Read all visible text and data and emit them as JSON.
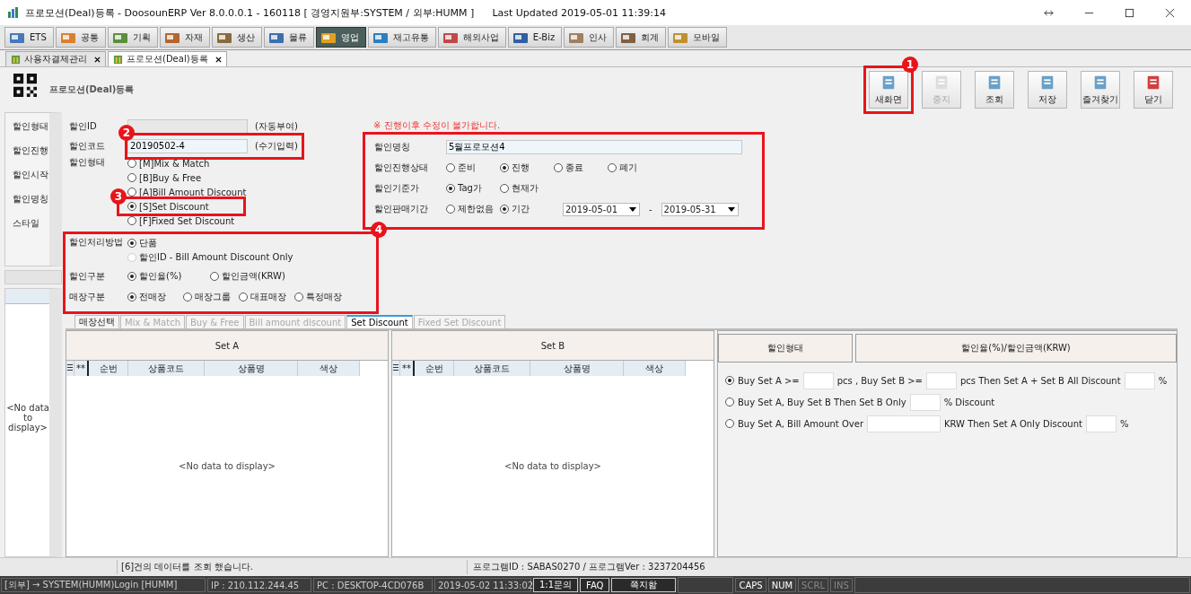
{
  "window": {
    "title": "프로모션(Deal)등록 - DoosounERP Ver 8.0.0.0.1 - 160118 [ 경영지원부:SYSTEM / 외부:HUMM ]",
    "last_updated": "Last Updated 2019-05-01 11:39:14"
  },
  "module_tabs": [
    {
      "label": "ETS",
      "selected": false
    },
    {
      "label": "공통",
      "selected": false
    },
    {
      "label": "기획",
      "selected": false
    },
    {
      "label": "자재",
      "selected": false
    },
    {
      "label": "생산",
      "selected": false
    },
    {
      "label": "물류",
      "selected": false
    },
    {
      "label": "영업",
      "selected": true
    },
    {
      "label": "재고유통",
      "selected": false
    },
    {
      "label": "해외사업",
      "selected": false
    },
    {
      "label": "E-Biz",
      "selected": false
    },
    {
      "label": "인사",
      "selected": false
    },
    {
      "label": "회계",
      "selected": false
    },
    {
      "label": "모바일",
      "selected": false
    }
  ],
  "doc_tabs": [
    {
      "label": "사용자결제관리",
      "selected": false
    },
    {
      "label": "프로모션(Deal)등록",
      "selected": true
    }
  ],
  "page_title": "프로모션(Deal)등록",
  "toolbar": [
    {
      "label": "새화면",
      "disabled": false,
      "annotation": "1"
    },
    {
      "label": "중지",
      "disabled": true
    },
    {
      "label": "조회",
      "disabled": false
    },
    {
      "label": "저장",
      "disabled": false
    },
    {
      "label": "즐겨찾기",
      "disabled": false
    },
    {
      "label": "닫기",
      "disabled": false
    }
  ],
  "sidebar": {
    "filters": [
      "할인형태",
      "할인진행",
      "할인시작",
      "할인명칭",
      "스타일"
    ],
    "empty": "<No data to display>"
  },
  "form": {
    "id": {
      "label": "할인ID",
      "note": "(자동부여)"
    },
    "code": {
      "label": "할인코드",
      "value": "20190502-4",
      "note": "(수기입력)",
      "annotation": "2"
    },
    "type": {
      "label": "할인형태",
      "options": [
        {
          "label": "[M]Mix & Match",
          "selected": false
        },
        {
          "label": "[B]Buy & Free",
          "selected": false
        },
        {
          "label": "[A]Bill Amount Discount",
          "selected": false
        },
        {
          "label": "[S]Set Discount",
          "selected": true,
          "annotation": "3"
        },
        {
          "label": "[F]Fixed Set Discount",
          "selected": false
        }
      ]
    },
    "annotation": "4",
    "method": {
      "label": "할인처리방법",
      "options": [
        {
          "label": "단품",
          "selected": true,
          "disabled": false
        },
        {
          "label": "할인ID - Bill Amount Discount Only",
          "selected": false,
          "disabled": true
        }
      ]
    },
    "dc_kind": {
      "label": "할인구분",
      "options": [
        {
          "label": "할인율(%)",
          "selected": true
        },
        {
          "label": "할인금액(KRW)",
          "selected": false
        }
      ]
    },
    "store": {
      "label": "매장구분",
      "options": [
        {
          "label": "전매장",
          "selected": true
        },
        {
          "label": "매장그룹",
          "selected": false
        },
        {
          "label": "대표매장",
          "selected": false
        },
        {
          "label": "특정매장",
          "selected": false
        }
      ]
    },
    "warning": "※ 진행이후 수정이 불가합니다.",
    "name": {
      "label": "할인명칭",
      "value": "5월프로모션4"
    },
    "status": {
      "label": "할인진행상태",
      "options": [
        {
          "label": "준비",
          "selected": false
        },
        {
          "label": "진행",
          "selected": true
        },
        {
          "label": "종료",
          "selected": false
        },
        {
          "label": "폐기",
          "selected": false
        }
      ]
    },
    "base": {
      "label": "할인기준가",
      "options": [
        {
          "label": "Tag가",
          "selected": true
        },
        {
          "label": "현재가",
          "selected": false
        }
      ]
    },
    "period": {
      "label": "할인판매기간",
      "options": [
        {
          "label": "제한없음",
          "selected": false
        },
        {
          "label": "기간",
          "selected": true
        }
      ],
      "from": "2019-05-01",
      "separator": "-",
      "to": "2019-05-31"
    }
  },
  "detail_tabs": [
    {
      "label": "매장선택",
      "selected": false,
      "disabled": false
    },
    {
      "label": "Mix & Match",
      "selected": false,
      "disabled": true
    },
    {
      "label": "Buy & Free",
      "selected": false,
      "disabled": true
    },
    {
      "label": "Bill amount discount",
      "selected": false,
      "disabled": true
    },
    {
      "label": "Set Discount",
      "selected": true,
      "disabled": false
    },
    {
      "label": "Fixed Set Discount",
      "selected": false,
      "disabled": true
    }
  ],
  "grids": [
    {
      "title": "Set A",
      "marker": "**",
      "columns": [
        "순번",
        "상품코드",
        "상품명",
        "색상"
      ],
      "empty": "<No data to display>"
    },
    {
      "title": "Set B",
      "marker": "**",
      "columns": [
        "순번",
        "상품코드",
        "상품명",
        "색상"
      ],
      "empty": "<No data to display>"
    }
  ],
  "set_panel": {
    "headers": [
      "할인형태",
      "할인율(%)/할인금액(KRW)"
    ],
    "rows": [
      {
        "selected": true,
        "parts": [
          {
            "kind": "text",
            "text": "Buy Set A >="
          },
          {
            "kind": "field"
          },
          {
            "kind": "text",
            "text": "pcs , Buy Set B >="
          },
          {
            "kind": "field"
          },
          {
            "kind": "text",
            "text": "pcs Then Set A + Set B All Discount"
          },
          {
            "kind": "field"
          },
          {
            "kind": "text",
            "text": "%"
          }
        ]
      },
      {
        "selected": false,
        "parts": [
          {
            "kind": "text",
            "text": "Buy Set A, Buy Set B Then Set B Only"
          },
          {
            "kind": "field"
          },
          {
            "kind": "text",
            "text": "% Discount"
          }
        ]
      },
      {
        "selected": false,
        "parts": [
          {
            "kind": "text",
            "text": "Buy Set A, Bill Amount Over"
          },
          {
            "kind": "wide_field"
          },
          {
            "kind": "text",
            "text": "KRW Then Set A Only Discount"
          },
          {
            "kind": "field"
          },
          {
            "kind": "text",
            "text": "%"
          }
        ]
      }
    ]
  },
  "status_bar": {
    "message": "[6]건의 데이터를 조회 했습니다.",
    "program": "프로그램ID : SABAS0270 / 프로그램Ver : 3237204456"
  },
  "footer": {
    "info": [
      "[외부]  → SYSTEM(HUMM)Login [HUMM]",
      "IP : 210.112.244.45",
      "PC : DESKTOP-4CD076B",
      "2019-05-02 11:33:02"
    ],
    "buttons": [
      "1:1문의",
      "FAQ",
      "쪽지함"
    ],
    "keys": [
      {
        "label": "CAPS",
        "on": true
      },
      {
        "label": "NUM",
        "on": true
      },
      {
        "label": "SCRL",
        "on": false
      },
      {
        "label": "INS",
        "on": false
      }
    ]
  }
}
